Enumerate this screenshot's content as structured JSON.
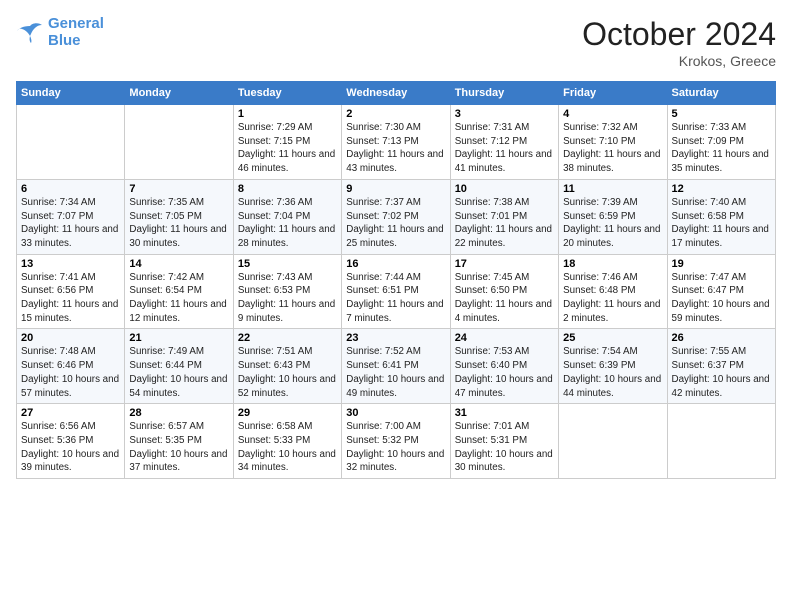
{
  "header": {
    "logo_line1": "General",
    "logo_line2": "Blue",
    "month_title": "October 2024",
    "location": "Krokos, Greece"
  },
  "weekdays": [
    "Sunday",
    "Monday",
    "Tuesday",
    "Wednesday",
    "Thursday",
    "Friday",
    "Saturday"
  ],
  "weeks": [
    [
      {
        "day": "",
        "info": ""
      },
      {
        "day": "",
        "info": ""
      },
      {
        "day": "1",
        "info": "Sunrise: 7:29 AM\nSunset: 7:15 PM\nDaylight: 11 hours and 46 minutes."
      },
      {
        "day": "2",
        "info": "Sunrise: 7:30 AM\nSunset: 7:13 PM\nDaylight: 11 hours and 43 minutes."
      },
      {
        "day": "3",
        "info": "Sunrise: 7:31 AM\nSunset: 7:12 PM\nDaylight: 11 hours and 41 minutes."
      },
      {
        "day": "4",
        "info": "Sunrise: 7:32 AM\nSunset: 7:10 PM\nDaylight: 11 hours and 38 minutes."
      },
      {
        "day": "5",
        "info": "Sunrise: 7:33 AM\nSunset: 7:09 PM\nDaylight: 11 hours and 35 minutes."
      }
    ],
    [
      {
        "day": "6",
        "info": "Sunrise: 7:34 AM\nSunset: 7:07 PM\nDaylight: 11 hours and 33 minutes."
      },
      {
        "day": "7",
        "info": "Sunrise: 7:35 AM\nSunset: 7:05 PM\nDaylight: 11 hours and 30 minutes."
      },
      {
        "day": "8",
        "info": "Sunrise: 7:36 AM\nSunset: 7:04 PM\nDaylight: 11 hours and 28 minutes."
      },
      {
        "day": "9",
        "info": "Sunrise: 7:37 AM\nSunset: 7:02 PM\nDaylight: 11 hours and 25 minutes."
      },
      {
        "day": "10",
        "info": "Sunrise: 7:38 AM\nSunset: 7:01 PM\nDaylight: 11 hours and 22 minutes."
      },
      {
        "day": "11",
        "info": "Sunrise: 7:39 AM\nSunset: 6:59 PM\nDaylight: 11 hours and 20 minutes."
      },
      {
        "day": "12",
        "info": "Sunrise: 7:40 AM\nSunset: 6:58 PM\nDaylight: 11 hours and 17 minutes."
      }
    ],
    [
      {
        "day": "13",
        "info": "Sunrise: 7:41 AM\nSunset: 6:56 PM\nDaylight: 11 hours and 15 minutes."
      },
      {
        "day": "14",
        "info": "Sunrise: 7:42 AM\nSunset: 6:54 PM\nDaylight: 11 hours and 12 minutes."
      },
      {
        "day": "15",
        "info": "Sunrise: 7:43 AM\nSunset: 6:53 PM\nDaylight: 11 hours and 9 minutes."
      },
      {
        "day": "16",
        "info": "Sunrise: 7:44 AM\nSunset: 6:51 PM\nDaylight: 11 hours and 7 minutes."
      },
      {
        "day": "17",
        "info": "Sunrise: 7:45 AM\nSunset: 6:50 PM\nDaylight: 11 hours and 4 minutes."
      },
      {
        "day": "18",
        "info": "Sunrise: 7:46 AM\nSunset: 6:48 PM\nDaylight: 11 hours and 2 minutes."
      },
      {
        "day": "19",
        "info": "Sunrise: 7:47 AM\nSunset: 6:47 PM\nDaylight: 10 hours and 59 minutes."
      }
    ],
    [
      {
        "day": "20",
        "info": "Sunrise: 7:48 AM\nSunset: 6:46 PM\nDaylight: 10 hours and 57 minutes."
      },
      {
        "day": "21",
        "info": "Sunrise: 7:49 AM\nSunset: 6:44 PM\nDaylight: 10 hours and 54 minutes."
      },
      {
        "day": "22",
        "info": "Sunrise: 7:51 AM\nSunset: 6:43 PM\nDaylight: 10 hours and 52 minutes."
      },
      {
        "day": "23",
        "info": "Sunrise: 7:52 AM\nSunset: 6:41 PM\nDaylight: 10 hours and 49 minutes."
      },
      {
        "day": "24",
        "info": "Sunrise: 7:53 AM\nSunset: 6:40 PM\nDaylight: 10 hours and 47 minutes."
      },
      {
        "day": "25",
        "info": "Sunrise: 7:54 AM\nSunset: 6:39 PM\nDaylight: 10 hours and 44 minutes."
      },
      {
        "day": "26",
        "info": "Sunrise: 7:55 AM\nSunset: 6:37 PM\nDaylight: 10 hours and 42 minutes."
      }
    ],
    [
      {
        "day": "27",
        "info": "Sunrise: 6:56 AM\nSunset: 5:36 PM\nDaylight: 10 hours and 39 minutes."
      },
      {
        "day": "28",
        "info": "Sunrise: 6:57 AM\nSunset: 5:35 PM\nDaylight: 10 hours and 37 minutes."
      },
      {
        "day": "29",
        "info": "Sunrise: 6:58 AM\nSunset: 5:33 PM\nDaylight: 10 hours and 34 minutes."
      },
      {
        "day": "30",
        "info": "Sunrise: 7:00 AM\nSunset: 5:32 PM\nDaylight: 10 hours and 32 minutes."
      },
      {
        "day": "31",
        "info": "Sunrise: 7:01 AM\nSunset: 5:31 PM\nDaylight: 10 hours and 30 minutes."
      },
      {
        "day": "",
        "info": ""
      },
      {
        "day": "",
        "info": ""
      }
    ]
  ]
}
